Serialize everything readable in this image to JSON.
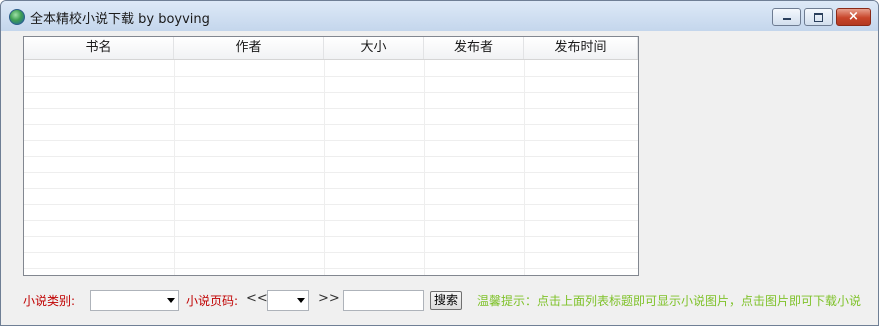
{
  "window": {
    "title": "全本精校小说下载 by boyving",
    "icon": "globe-icon",
    "controls": [
      "minimize",
      "maximize",
      "close"
    ],
    "close_glyph": "×"
  },
  "list": {
    "columns": [
      "书名",
      "作者",
      "大小",
      "发布者",
      "发布时间"
    ],
    "rows": []
  },
  "filters": {
    "category_label": "小说类别:",
    "category_value": "",
    "page_label": "小说页码:",
    "prev_label": "<<",
    "next_label": ">>",
    "page_value": "",
    "search_value": "",
    "search_button": "搜索"
  },
  "tip": "温馨提示：点击上面列表标题即可显示小说图片，点击图片即可下载小说",
  "colors": {
    "label_red": "#c00000",
    "tip_green": "#7fc22a"
  }
}
